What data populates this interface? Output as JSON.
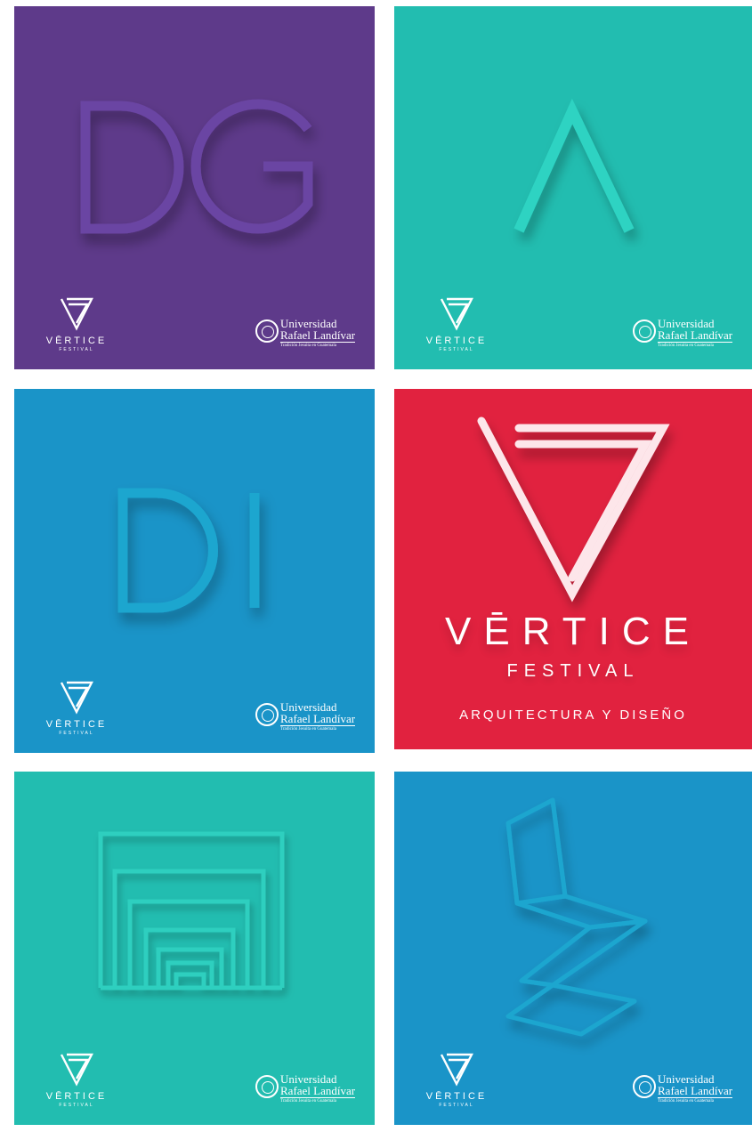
{
  "brand": {
    "name": "VĒRTICE",
    "sub": "FESTIVAL"
  },
  "university": {
    "line1": "Universidad",
    "line2": "Rafael Landívar",
    "line3": "Tradición Jesuita en Guatemala"
  },
  "hero": {
    "title": "VĒRTICE",
    "subtitle": "FESTIVAL",
    "tagline": "ARQUITECTURA Y DISEÑO"
  },
  "tiles": [
    {
      "letters": "DG",
      "color": "#5e3a8a",
      "icon": "dg-letters-icon"
    },
    {
      "letters": "",
      "color": "#22bdb0",
      "icon": "caret-icon"
    },
    {
      "letters": "DI",
      "color": "#1a94c8",
      "icon": "di-letters-icon"
    },
    {
      "letters": "",
      "color": "#e1223f",
      "icon": "vertice-logo-icon"
    },
    {
      "letters": "",
      "color": "#22bdb0",
      "icon": "nested-squares-icon"
    },
    {
      "letters": "",
      "color": "#1a94c8",
      "icon": "zig-zag-chair-icon"
    }
  ]
}
